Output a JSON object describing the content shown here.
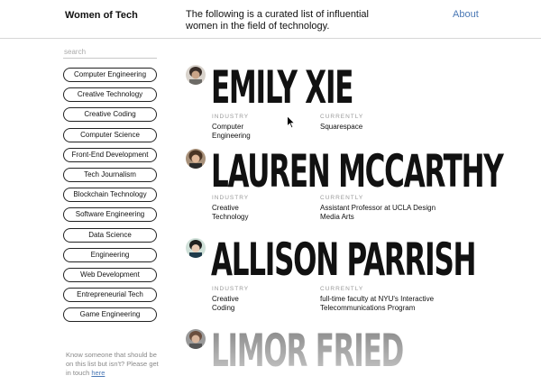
{
  "header": {
    "site_title": "Women of Tech",
    "intro": "The following is a curated list of influential women in the field of technology.",
    "about_label": "About"
  },
  "sidebar": {
    "search_placeholder": "search",
    "tags": [
      "Computer Engineering",
      "Creative Technology",
      "Creative Coding",
      "Computer Science",
      "Front-End Development",
      "Tech Journalism",
      "Blockchain Technology",
      "Software Engineering",
      "Data Science",
      "Engineering",
      "Web Development",
      "Entrepreneurial Tech",
      "Game Engineering"
    ],
    "footer_text": "Know someone that should be on this list but isn't? Please get in touch",
    "footer_link": "here"
  },
  "people": [
    {
      "name": "EMILY XIE",
      "industry_label": "INDUSTRY",
      "industry": "Computer Engineering",
      "currently_label": "CURRENTLY",
      "currently": "Squarespace"
    },
    {
      "name": "LAUREN MCCARTHY",
      "industry_label": "INDUSTRY",
      "industry": "Creative Technology",
      "currently_label": "CURRENTLY",
      "currently": "Assistant Professor at UCLA Design Media Arts"
    },
    {
      "name": "ALLISON PARRISH",
      "industry_label": "INDUSTRY",
      "industry": "Creative Coding",
      "currently_label": "CURRENTLY",
      "currently": "full-time faculty at NYU's Interactive Telecommunications Program"
    },
    {
      "name": "LIMOR FRIED"
    }
  ],
  "colors": {
    "link": "#4a78b5",
    "text": "#111111",
    "muted": "#9a9a9a"
  },
  "icons": {
    "cursor": "arrow-cursor-icon"
  }
}
